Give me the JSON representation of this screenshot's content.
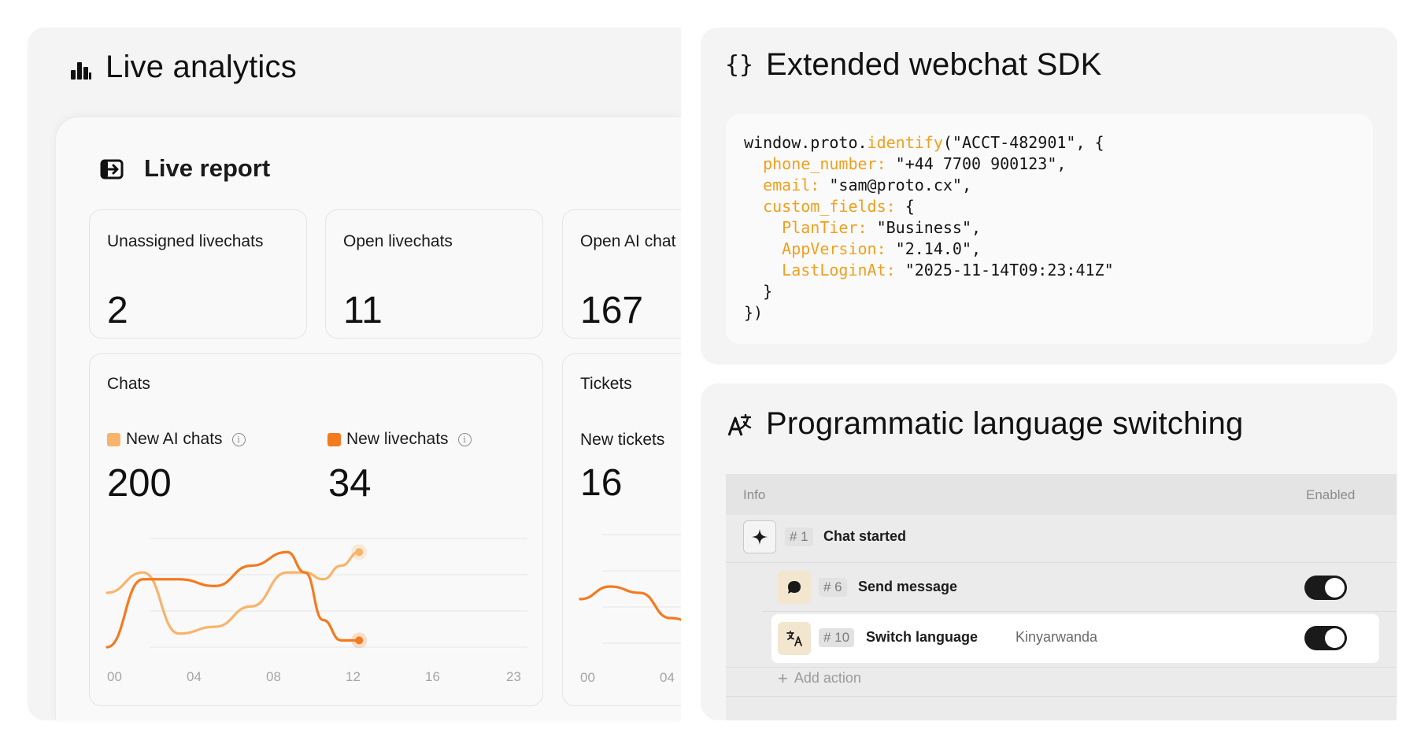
{
  "analytics": {
    "title": "Live analytics",
    "icon": "bar-chart-icon",
    "report": {
      "icon": "enter-box-icon",
      "title": "Live report",
      "stats": [
        {
          "label": "Unassigned livechats",
          "value": "2"
        },
        {
          "label": "Open livechats",
          "value": "11"
        },
        {
          "label": "Open AI chat",
          "value": "167"
        }
      ],
      "chats_card": {
        "title": "Chats",
        "legend": [
          {
            "label": "New AI chats",
            "color": "#f8b46a",
            "value": "200"
          },
          {
            "label": "New livechats",
            "color": "#f47a1f",
            "value": "34"
          }
        ],
        "x_ticks": [
          "00",
          "04",
          "08",
          "12",
          "16",
          "23"
        ]
      },
      "tickets_card": {
        "title": "Tickets",
        "legend_label": "New tickets",
        "value": "16",
        "x_ticks": [
          "00",
          "04"
        ]
      }
    }
  },
  "chart_data": [
    {
      "type": "line",
      "x": [
        0,
        2,
        4,
        6,
        8,
        10,
        11,
        12,
        13,
        14
      ],
      "series": [
        {
          "name": "New AI chats",
          "color": "#f8b46a",
          "values": [
            8,
            11,
            2,
            3,
            6,
            11,
            11,
            10,
            12,
            14
          ]
        },
        {
          "name": "New livechats",
          "color": "#f47a1f",
          "values": [
            0,
            10,
            10,
            9,
            12,
            14,
            11,
            4,
            1,
            1
          ]
        }
      ],
      "xlim": [
        0,
        23
      ],
      "x_ticks": [
        "00",
        "04",
        "08",
        "12",
        "16",
        "23"
      ],
      "grid": true
    },
    {
      "type": "line",
      "series": [
        {
          "color": "#f47a1f",
          "values": [
            3,
            5,
            4,
            0,
            -1
          ]
        }
      ],
      "x_ticks": [
        "00",
        "04"
      ]
    }
  ],
  "sdk": {
    "title": "Extended webchat SDK",
    "icon": "curly-braces-icon",
    "code": {
      "l1_a": "window.proto.",
      "l1_fn": "identify",
      "l1_b": "(\"ACCT-482901\", {",
      "l2_k": "phone_number:",
      "l2_v": " \"+44 7700 900123\",",
      "l3_k": "email:",
      "l3_v": " \"sam@proto.cx\",",
      "l4_k": "custom_fields:",
      "l4_v": " {",
      "l5_k": "PlanTier:",
      "l5_v": " \"Business\",",
      "l6_k": "AppVersion:",
      "l6_v": " \"2.14.0\",",
      "l7_k": "LastLoginAt:",
      "l7_v": " \"2025-11-14T09:23:41Z\"",
      "l8": "}",
      "l9": "})"
    }
  },
  "language": {
    "title": "Programmatic language switching",
    "icon": "translate-icon",
    "table": {
      "col_info": "Info",
      "col_enabled": "Enabled",
      "rows": [
        {
          "num": "# 1",
          "label": "Chat started",
          "icon": "sparkle-icon"
        },
        {
          "num": "# 6",
          "label": "Send message",
          "icon": "chat-bubble-icon",
          "enabled": true
        },
        {
          "num": "# 10",
          "label": "Switch language",
          "icon": "language-icon",
          "value": "Kinyarwanda",
          "enabled": true
        }
      ],
      "add_action": "Add action"
    }
  }
}
